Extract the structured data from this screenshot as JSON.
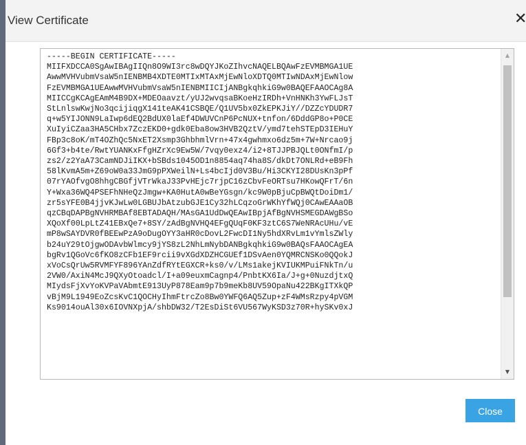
{
  "dialog": {
    "title": "View Certificate",
    "close_icon_glyph": "✕",
    "close_button_label": "Close",
    "colors": {
      "header_bg": "#f3f3f3",
      "button_bg": "#3aa3e3",
      "left_edge": "#5f6b7a"
    }
  },
  "certificate": {
    "text": "-----BEGIN CERTIFICATE-----\nMIIFXDCCA0SgAwIBAgIIQn8O9WI3rc8wDQYJKoZIhvcNAQELBQAwFzEVMBMGA1UE\nAwwMVHVubmVsaW5nIENBMB4XDTE0MTIxMTAxMjEwNloXDTQ0MTIwNDAxMjEwNlow\nFzEVMBMGA1UEAwwMVHVubmVsaW5nIENBMIICIjANBgkqhkiG9w0BAQEFAAOCAg8A\nMIICCgKCAgEAmM4B9DX+MDEOaavzt/yUJ2wvqsaBKoeHzIRDh+VnHNKh3YwFLJsT\nStLnlswKwjNo3qcijiqgX141teAK41CSBQE/Q1UV5bx0ZkEPKJiY//DZZcYDUDR7\nq+w5YIJONN9LaIwp6dEQ2BdUX0laEf4DWUVCnP6PcNUX+tnfon/6DddGP8o+P0CE\nXuIyiCZaa3HA5CHbx7ZczEKD0+gdk0Eba8ow3HVB2QztV/ymd7tehSTEpD3IEHuY\nFBp3c8oK/mT4OZhQc5NxET2Xsmp3GhbhmlVrn+47x4gwhmxo6dz5m+7W+Nrcao9j\n6Gf3+b4te/RwtYUANKxFfgHZrXc9Ew5W/7vqy0exz4/i2+8TJJPBJQLt0ONfmI/p\nzs2/z2YaA73CamNDJiIKX+bSBds1045OD1n8854aq74ha8S/dkDt7ONLRd+eB9Fh\n58lKvmA5m+Z69oW0a33JmG9pPXWeilN+Ls4bcIjd0V3Bu/Hi3CKYI28DUsKn3pPf\n07rYAOfvgO8hhgCBGfjVTrWkaJ33PvHEjc7rjpC16zCbvFeORTsu7HKowQFrT/6n\nY+Wxa36WQ4PSEFhNHeQzJmgw+KA0HutA0wBeYGsgn/kc9W0pBjuCpBWQtDoiDm1/\nzr5sYFE0B4jjvKJwLw0LGBUJbAtzubGJE1Cy32hLCqzoGrWKhYfWQj0CAwEAAaOB\nqzCBqDAPBgNVHRMBAf8EBTADAQH/MAsGA1UdDwQEAwIBpjAfBgNVHSMEGDAWgBSo\nXQoXf00LpLtZ41EBxQe7+8SY/zAdBgNVHQ4EFgQUqF0KF3ztC6S7WeNRAcUHu/vE\nmP8wSAYDVR0fBEEwPzA9oDugOYY3aHR0cDovL2FwcDI1Ny5hdXRvLm1vYmlsZWly\nb24uY29tOjgwODAvbWlmcy9jYS8zL2NhLmNybDANBgkqhkiG9w0BAQsFAAOCAgEA\nbgRv1QGoVc6fKO8zCFb1EF9rcii9vXGdXDZHCGUEf1DSvAen0YQMRCNSKo0QQokJ\nxVoCsQrUw5RVMFYF896YAnZdfRYtEGXCR+ks0/v/LMs1akejKVIUKMPuiFNkTn/u\n2VW0/AxiN4McJ9QXyOtoadcl/I+a09euxmCagnp4/PnbtKX6Ia/J+g+0NuzdjtxQ\nMIydsFjXvYoKVPaVAbmtE913UyP878Eam9p7b9meKb8UV59OpaNu422BKgITXkQP\nvBjM9L1949EoZcsKvC1QOCHyIhmFtrcZo8Bw0YWFQ6AQ5Zup+zF4WMsRzpy4pVGM\nKs9014ouAl30x6IOVNXpjA/shbDW32/T2EsDiSt6VU567WyKSD3z70R+hySKv0xJ"
  }
}
